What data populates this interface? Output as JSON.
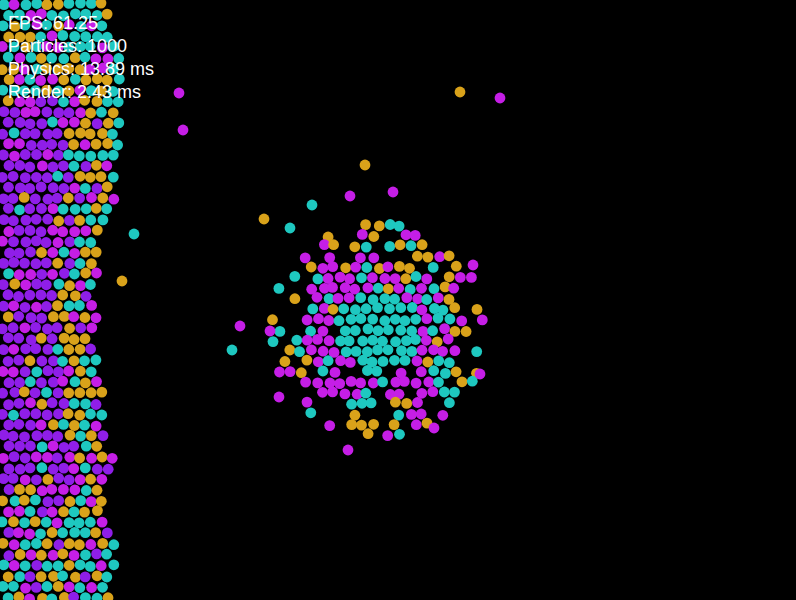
{
  "stats": [
    "FPS: 61.25",
    "Particles: 1000",
    "Physics: 13.89 ms",
    "Render: 2.43 ms"
  ],
  "species": [
    {
      "color": "#c51ee6"
    },
    {
      "color": "#8f1ee8"
    },
    {
      "color": "#1ec8c0"
    },
    {
      "color": "#d9a21a"
    }
  ]
}
